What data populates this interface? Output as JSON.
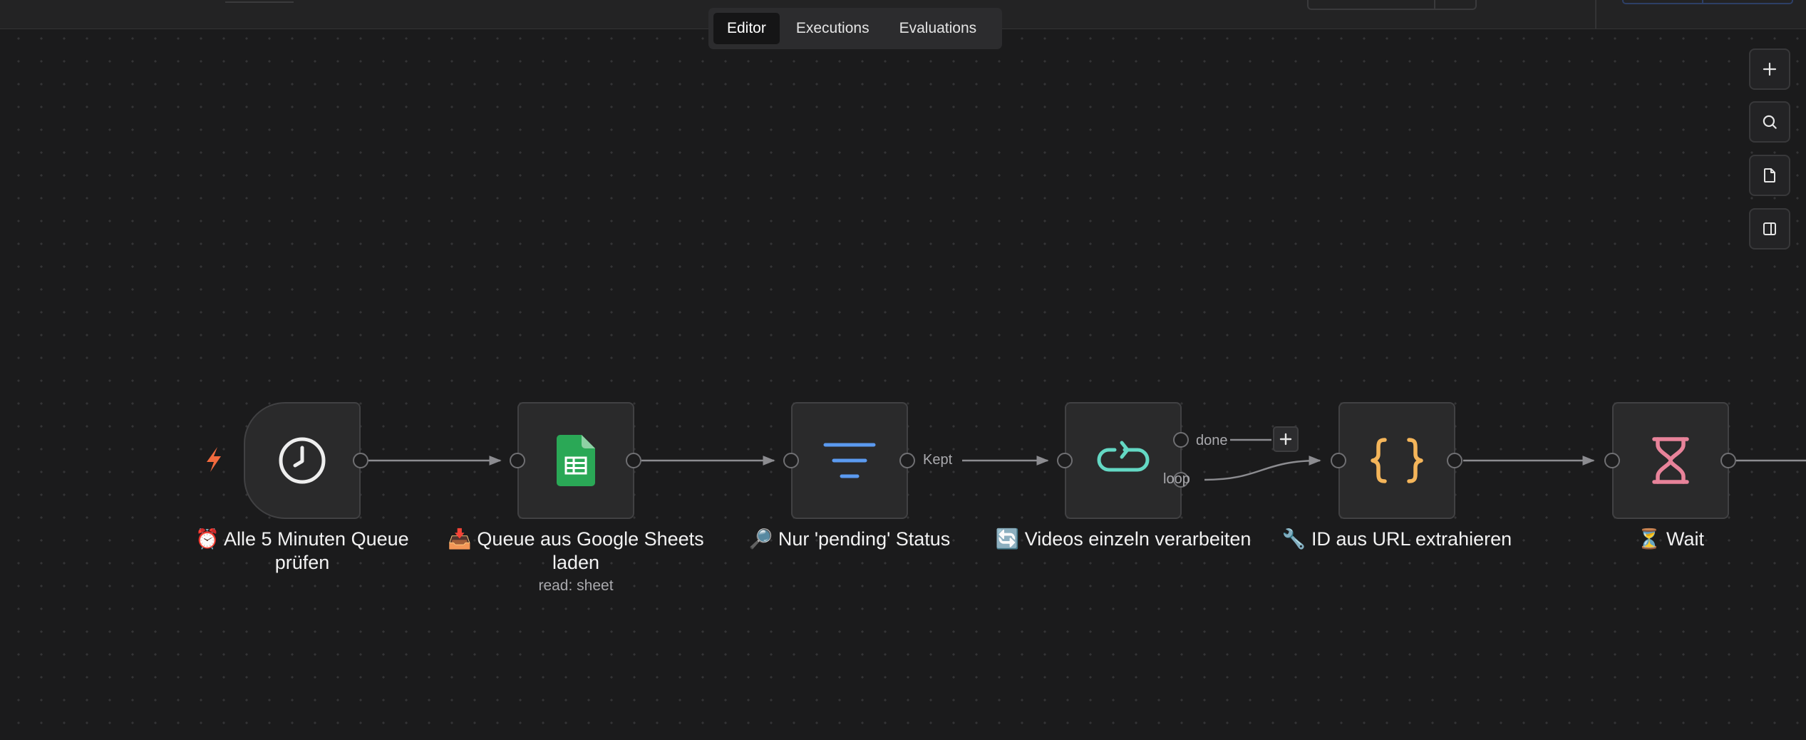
{
  "tabs": [
    {
      "label": "Editor",
      "active": true
    },
    {
      "label": "Executions",
      "active": false
    },
    {
      "label": "Evaluations",
      "active": false
    }
  ],
  "toolbar": {
    "buttons": [
      {
        "name": "zoom-in",
        "icon": "plus-icon"
      },
      {
        "name": "search",
        "icon": "search-icon"
      },
      {
        "name": "sticky-note",
        "icon": "sticky-note-icon"
      },
      {
        "name": "toggle-panel",
        "icon": "panel-icon"
      }
    ]
  },
  "nodes": [
    {
      "id": "trigger",
      "label": "⏰ Alle 5 Minuten Queue prüfen",
      "icon": "clock-icon",
      "color": "#e8e8e8"
    },
    {
      "id": "sheets",
      "label": "📥 Queue aus Google Sheets laden",
      "sublabel": "read: sheet",
      "icon": "google-sheets-icon",
      "color": "#2aa856"
    },
    {
      "id": "filter",
      "label": "🔎 Nur 'pending' Status",
      "icon": "filter-icon",
      "color": "#5b9af0"
    },
    {
      "id": "loop",
      "label": "🔄 Videos einzeln verarbeiten",
      "icon": "loop-icon",
      "color": "#64d8c4"
    },
    {
      "id": "code",
      "label": "🔧 ID aus URL extrahieren",
      "icon": "code-braces-icon",
      "color": "#f4b55a"
    },
    {
      "id": "wait",
      "label": "⏳ Wait",
      "icon": "hourglass-icon",
      "color": "#e8839a"
    }
  ],
  "edge_labels": {
    "kept": "Kept",
    "done": "done",
    "loop": "loop"
  },
  "colors": {
    "trigger_bolt": "#f26a3e",
    "background": "#1b1b1c",
    "node_fill": "#2a2a2b"
  }
}
